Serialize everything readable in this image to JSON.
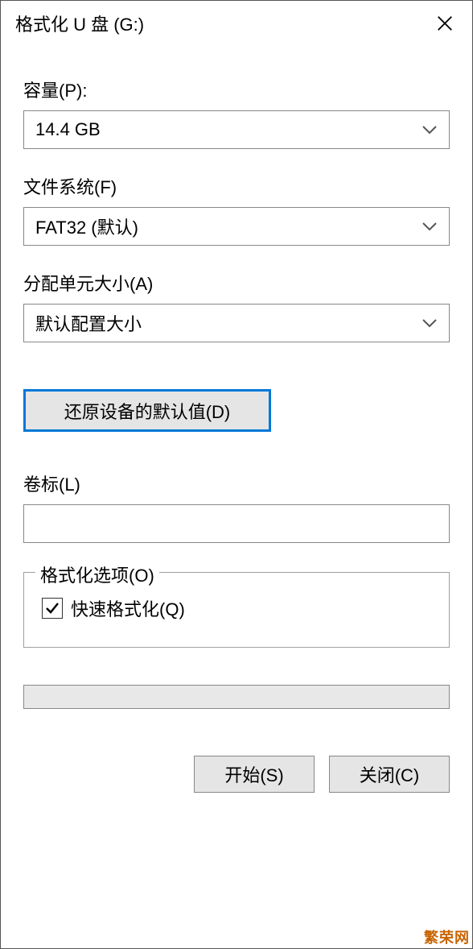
{
  "window": {
    "title": "格式化 U 盘 (G:)"
  },
  "fields": {
    "capacity": {
      "label": "容量(P):",
      "value": "14.4 GB"
    },
    "filesystem": {
      "label": "文件系统(F)",
      "value": "FAT32 (默认)"
    },
    "allocation": {
      "label": "分配单元大小(A)",
      "value": "默认配置大小"
    },
    "volume_label": {
      "label": "卷标(L)",
      "value": ""
    }
  },
  "buttons": {
    "restore": "还原设备的默认值(D)",
    "start": "开始(S)",
    "close": "关闭(C)"
  },
  "options": {
    "legend": "格式化选项(O)",
    "quick_format": "快速格式化(Q)",
    "quick_format_checked": true
  },
  "watermark": "繁荣网"
}
